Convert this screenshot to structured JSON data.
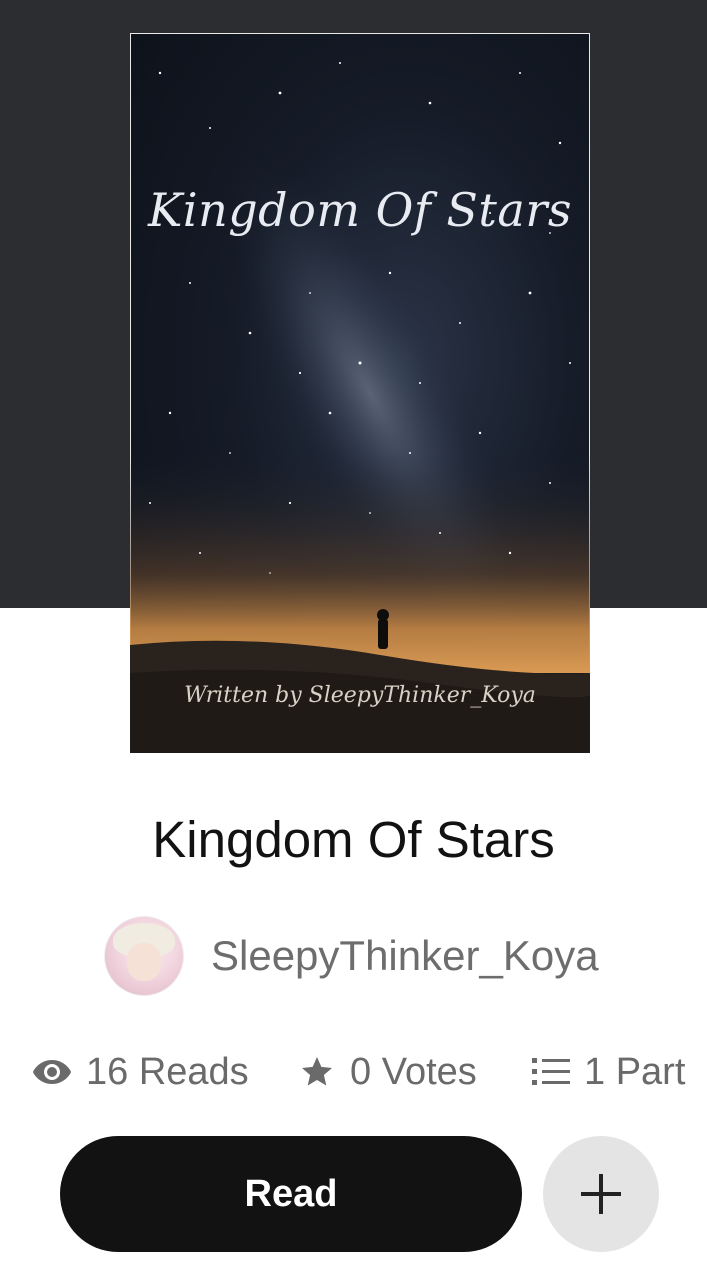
{
  "cover": {
    "title_text": "Kingdom Of Stars",
    "byline_text": "Written by SleepyThinker_Koya"
  },
  "story": {
    "title": "Kingdom Of Stars"
  },
  "author": {
    "name": "SleepyThinker_Koya"
  },
  "stats": {
    "reads": "16 Reads",
    "votes": "0 Votes",
    "parts": "1 Part"
  },
  "actions": {
    "read_label": "Read"
  },
  "icons": {
    "reads": "eye-icon",
    "votes": "star-icon",
    "parts": "list-icon",
    "add": "plus-icon"
  },
  "colors": {
    "header_background": "#2c2d31",
    "primary_button": "#121212",
    "secondary_button": "#e4e4e4",
    "text_primary": "#121212",
    "text_secondary": "#6a6a6a"
  }
}
